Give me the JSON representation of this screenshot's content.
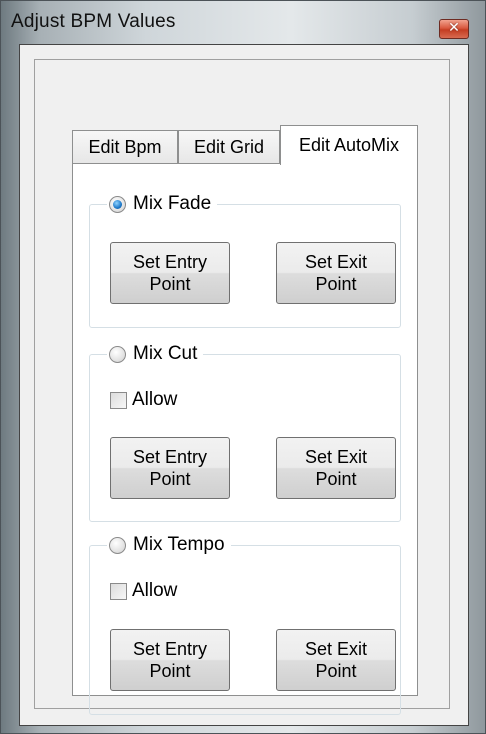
{
  "window": {
    "title": "Adjust BPM Values",
    "close_glyph": "✕"
  },
  "tabs": [
    {
      "label": "Edit Bpm"
    },
    {
      "label": "Edit Grid"
    },
    {
      "label": "Edit AutoMix"
    }
  ],
  "groups": [
    {
      "label": "Mix Fade",
      "selected": true,
      "entry_button": "Set Entry\nPoint",
      "exit_button": "Set Exit\nPoint"
    },
    {
      "label": "Mix Cut",
      "selected": false,
      "allow_label": "Allow",
      "allow_checked": false,
      "entry_button": "Set Entry\nPoint",
      "exit_button": "Set Exit\nPoint"
    },
    {
      "label": "Mix Tempo",
      "selected": false,
      "allow_label": "Allow",
      "allow_checked": false,
      "entry_button": "Set Entry\nPoint",
      "exit_button": "Set Exit\nPoint"
    }
  ],
  "colors": {
    "close_button": "#c43d22",
    "radio_checked": "#1d78c9"
  }
}
